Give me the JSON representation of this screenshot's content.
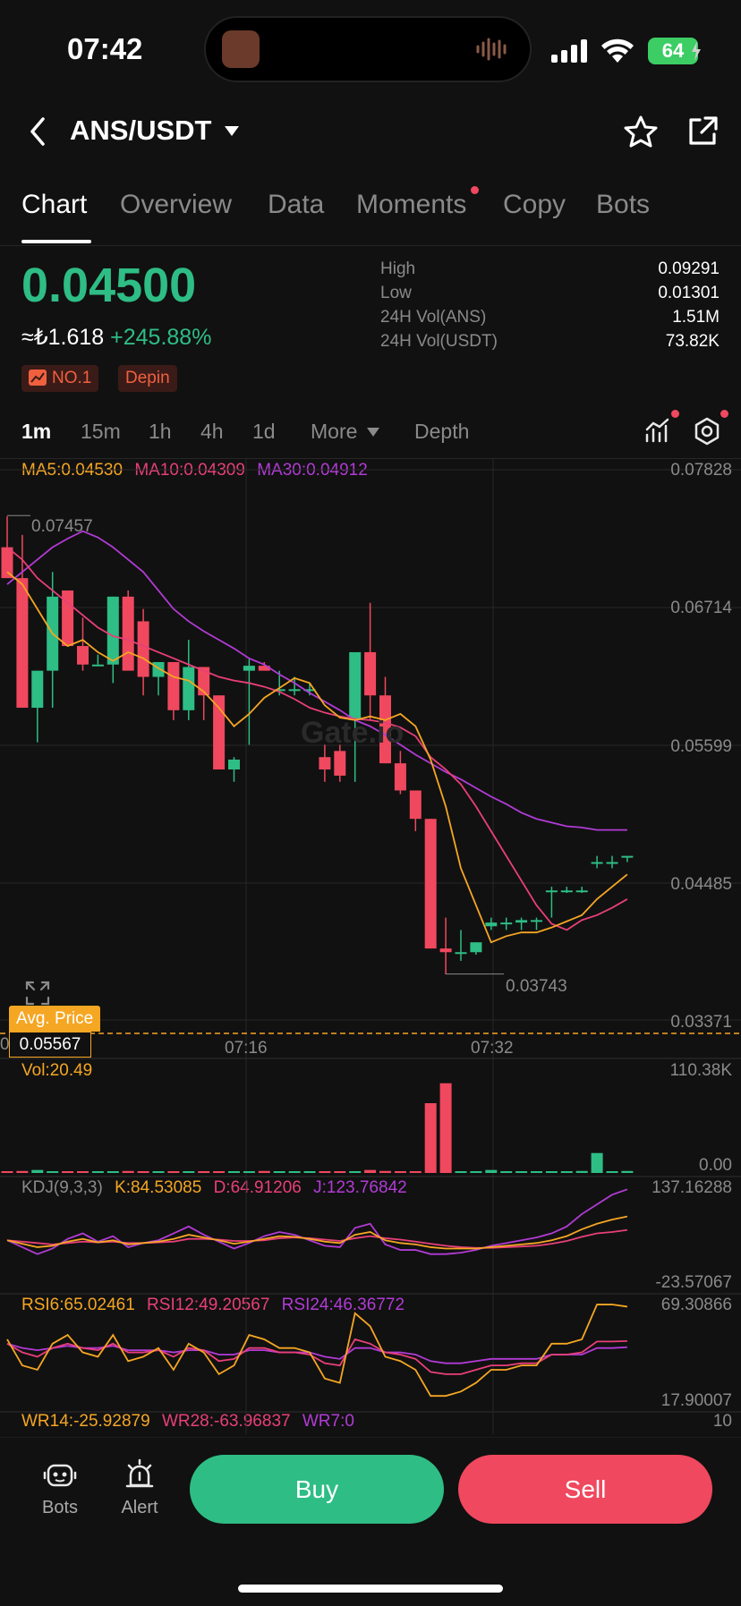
{
  "status_bar": {
    "time": "07:42",
    "battery": "64"
  },
  "header": {
    "pair": "ANS/USDT"
  },
  "tabs": [
    {
      "label": "Chart",
      "active": true
    },
    {
      "label": "Overview"
    },
    {
      "label": "Data"
    },
    {
      "label": "Moments",
      "dot": true
    },
    {
      "label": "Copy"
    },
    {
      "label": "Bots"
    }
  ],
  "ticker": {
    "price": "0.04500",
    "fiat": "≈₺1.618",
    "change": "+245.88%",
    "badges": [
      "NO.1",
      "Depin"
    ],
    "stats": [
      {
        "label": "High",
        "value": "0.09291"
      },
      {
        "label": "Low",
        "value": "0.01301"
      },
      {
        "label": "24H Vol(ANS)",
        "value": "1.51M"
      },
      {
        "label": "24H Vol(USDT)",
        "value": "73.82K"
      }
    ]
  },
  "intervals": {
    "items": [
      "1m",
      "15m",
      "1h",
      "4h",
      "1d",
      "More"
    ],
    "active": "1m",
    "depth_label": "Depth"
  },
  "indicators": {
    "ma": {
      "ma5": "MA5:0.04530",
      "ma10": "MA10:0.04309",
      "ma30": "MA30:0.04912"
    },
    "vol": "Vol:20.49",
    "kdj": {
      "title": "KDJ(9,3,3)",
      "k": "K:84.53085",
      "d": "D:64.91206",
      "j": "J:123.76842"
    },
    "rsi": {
      "r6": "RSI6:65.02461",
      "r12": "RSI12:49.20567",
      "r24": "RSI24:46.36772"
    },
    "wr": {
      "w14": "WR14:-25.92879",
      "w28": "WR28:-63.96837",
      "w7": "WR7:0"
    }
  },
  "axes": {
    "price": [
      "0.07828",
      "0.06714",
      "0.05599",
      "0.04485",
      "0.03371"
    ],
    "volume": [
      "110.38K",
      "0.00"
    ],
    "kdj": [
      "137.16288",
      "-23.57067"
    ],
    "rsi": [
      "69.30866",
      "17.90007"
    ],
    "wr": [
      "10"
    ],
    "time": [
      "07:16",
      "07:32"
    ]
  },
  "chart_labels": {
    "max_marker": "0.07457",
    "min_marker": "0.03743",
    "avg_price_label": "Avg. Price",
    "avg_price_value": "0.05567",
    "avg_price_axis_prefix": "0",
    "watermark": "Gate.io"
  },
  "chart_data": {
    "type": "candlestick",
    "x": [
      "07:01",
      "07:02",
      "07:03",
      "07:04",
      "07:05",
      "07:06",
      "07:07",
      "07:08",
      "07:09",
      "07:10",
      "07:11",
      "07:12",
      "07:13",
      "07:14",
      "07:15",
      "07:16",
      "07:17",
      "07:18",
      "07:19",
      "07:20",
      "07:21",
      "07:22",
      "07:23",
      "07:24",
      "07:25",
      "07:26",
      "07:27",
      "07:28",
      "07:29",
      "07:30",
      "07:31",
      "07:32",
      "07:33",
      "07:34",
      "07:35",
      "07:36",
      "07:37",
      "07:38",
      "07:39",
      "07:40",
      "07:41",
      "07:42"
    ],
    "open": [
      0.072,
      0.0695,
      0.059,
      0.062,
      0.0685,
      0.064,
      0.0625,
      0.0625,
      0.068,
      0.066,
      0.0615,
      0.0627,
      0.0588,
      0.0623,
      0.06,
      0.054,
      0.062,
      0.0624,
      0.0605,
      0.0605,
      0.0605,
      0.055,
      0.0555,
      0.058,
      0.0635,
      0.06,
      0.0545,
      0.0523,
      0.05,
      0.0395,
      0.0392,
      0.0392,
      0.0413,
      0.0416,
      0.0416,
      0.0418,
      0.0442,
      0.0442,
      0.0442,
      0.0465,
      0.0465,
      0.047
    ],
    "high": [
      0.0745,
      0.073,
      0.062,
      0.07,
      0.068,
      0.0663,
      0.0633,
      0.068,
      0.0685,
      0.067,
      0.062,
      0.0627,
      0.0645,
      0.0623,
      0.06,
      0.055,
      0.063,
      0.0627,
      0.062,
      0.0615,
      0.061,
      0.056,
      0.056,
      0.0635,
      0.0675,
      0.0615,
      0.0555,
      0.0523,
      0.05,
      0.042,
      0.041,
      0.04,
      0.042,
      0.042,
      0.042,
      0.042,
      0.0445,
      0.0445,
      0.0445,
      0.047,
      0.047,
      0.047
    ],
    "low": [
      0.07,
      0.059,
      0.0562,
      0.059,
      0.068,
      0.062,
      0.0625,
      0.061,
      0.065,
      0.06,
      0.06,
      0.058,
      0.058,
      0.058,
      0.056,
      0.053,
      0.056,
      0.0622,
      0.06,
      0.06,
      0.06,
      0.053,
      0.053,
      0.053,
      0.058,
      0.0545,
      0.052,
      0.049,
      0.0395,
      0.0374,
      0.0385,
      0.039,
      0.041,
      0.041,
      0.041,
      0.041,
      0.042,
      0.044,
      0.044,
      0.046,
      0.046,
      0.0465
    ],
    "close": [
      0.0695,
      0.059,
      0.062,
      0.068,
      0.064,
      0.0625,
      0.0625,
      0.068,
      0.062,
      0.0615,
      0.0627,
      0.0588,
      0.0623,
      0.06,
      0.054,
      0.0548,
      0.0624,
      0.062,
      0.0605,
      0.0605,
      0.0605,
      0.054,
      0.0535,
      0.0635,
      0.06,
      0.0545,
      0.0523,
      0.05,
      0.0395,
      0.0392,
      0.0392,
      0.04,
      0.0416,
      0.0416,
      0.0418,
      0.0418,
      0.0442,
      0.0442,
      0.0442,
      0.0465,
      0.0465,
      0.047
    ],
    "volume_k": [
      0,
      2,
      3,
      1,
      0,
      1,
      1,
      0,
      2,
      1,
      1,
      0,
      0,
      1,
      1,
      1,
      1,
      2,
      1,
      1,
      1,
      0,
      0,
      0,
      3,
      2,
      0,
      1,
      70,
      90,
      0,
      0,
      3,
      0,
      0,
      0,
      0,
      0,
      2,
      20,
      0,
      2
    ],
    "ma5": [
      0.07,
      0.069,
      0.067,
      0.065,
      0.064,
      0.0645,
      0.0635,
      0.0628,
      0.0635,
      0.063,
      0.0622,
      0.0615,
      0.0612,
      0.0603,
      0.059,
      0.0575,
      0.0585,
      0.0598,
      0.0606,
      0.0614,
      0.061,
      0.0592,
      0.0582,
      0.058,
      0.0583,
      0.058,
      0.0585,
      0.0575,
      0.0548,
      0.051,
      0.046,
      0.043,
      0.04,
      0.0405,
      0.0408,
      0.0408,
      0.0412,
      0.0417,
      0.0422,
      0.0435,
      0.0445,
      0.0455
    ],
    "ma10": [
      0.072,
      0.071,
      0.0695,
      0.0685,
      0.0675,
      0.0665,
      0.0655,
      0.0648,
      0.0645,
      0.064,
      0.0635,
      0.063,
      0.0625,
      0.062,
      0.0615,
      0.0612,
      0.061,
      0.0607,
      0.0603,
      0.0597,
      0.059,
      0.0586,
      0.0583,
      0.0581,
      0.058,
      0.0578,
      0.0574,
      0.0567,
      0.055,
      0.054,
      0.0528,
      0.051,
      0.049,
      0.047,
      0.045,
      0.043,
      0.0415,
      0.041,
      0.0418,
      0.0422,
      0.0428,
      0.0435
    ],
    "ma30": [
      0.069,
      0.07,
      0.071,
      0.072,
      0.0727,
      0.0733,
      0.0728,
      0.072,
      0.071,
      0.07,
      0.0685,
      0.067,
      0.066,
      0.0652,
      0.0645,
      0.0638,
      0.063,
      0.0625,
      0.0617,
      0.061,
      0.0602,
      0.0595,
      0.0588,
      0.058,
      0.0575,
      0.0568,
      0.056,
      0.0552,
      0.0545,
      0.0538,
      0.0532,
      0.0525,
      0.0518,
      0.0512,
      0.0505,
      0.05,
      0.0497,
      0.0494,
      0.0493,
      0.0491,
      0.0491,
      0.0491
    ],
    "ylim": [
      0.03371,
      0.07828
    ],
    "volume_ylim": [
      0,
      110.38
    ],
    "kdj": {
      "ylim": [
        -23.57067,
        137.16288
      ],
      "k": [
        50,
        45,
        40,
        42,
        48,
        52,
        47,
        50,
        44,
        46,
        48,
        52,
        58,
        54,
        50,
        45,
        48,
        52,
        56,
        55,
        52,
        48,
        46,
        58,
        62,
        50,
        46,
        44,
        40,
        38,
        38,
        38,
        40,
        42,
        44,
        46,
        50,
        56,
        66,
        74,
        80,
        84.53
      ],
      "d": [
        50,
        48,
        46,
        44,
        46,
        48,
        47,
        48,
        46,
        46,
        47,
        48,
        52,
        52,
        51,
        49,
        49,
        50,
        53,
        54,
        53,
        51,
        49,
        53,
        56,
        53,
        51,
        48,
        45,
        42,
        40,
        39,
        39,
        40,
        41,
        42,
        45,
        49,
        55,
        60,
        62,
        64.91
      ],
      "j": [
        50,
        40,
        30,
        38,
        52,
        60,
        48,
        56,
        40,
        46,
        50,
        60,
        70,
        58,
        48,
        38,
        46,
        56,
        62,
        58,
        50,
        42,
        40,
        68,
        74,
        44,
        36,
        36,
        30,
        30,
        32,
        36,
        42,
        46,
        50,
        54,
        60,
        70,
        88,
        102,
        116,
        123.77
      ]
    },
    "rsi": {
      "ylim": [
        17.90007,
        69.30866
      ],
      "rsi6": [
        50,
        38,
        36,
        48,
        52,
        44,
        42,
        52,
        40,
        42,
        46,
        36,
        48,
        44,
        34,
        38,
        52,
        50,
        46,
        46,
        44,
        32,
        30,
        62,
        56,
        42,
        40,
        36,
        24,
        24,
        26,
        30,
        36,
        36,
        38,
        38,
        48,
        48,
        50,
        66,
        66,
        65.02
      ],
      "rsi12": [
        48,
        44,
        42,
        46,
        48,
        46,
        45,
        48,
        44,
        44,
        45,
        42,
        46,
        45,
        40,
        41,
        46,
        46,
        44,
        44,
        43,
        39,
        38,
        50,
        48,
        44,
        43,
        41,
        35,
        34,
        34,
        36,
        38,
        38,
        39,
        39,
        43,
        43,
        44,
        49,
        49,
        49.21
      ],
      "rsi24": [
        48,
        46,
        45,
        46,
        47,
        46,
        46,
        47,
        45,
        45,
        45,
        44,
        45,
        45,
        43,
        43,
        45,
        45,
        44,
        44,
        44,
        42,
        41,
        46,
        46,
        44,
        44,
        43,
        40,
        39,
        39,
        40,
        41,
        41,
        41,
        41,
        43,
        43,
        43,
        46,
        46,
        46.37
      ]
    }
  },
  "bottom_bar": {
    "bots_label": "Bots",
    "alert_label": "Alert",
    "buy_label": "Buy",
    "sell_label": "Sell"
  },
  "colors": {
    "up": "#2ebd85",
    "down": "#f0485e",
    "ma5": "#f5a623",
    "ma10": "#e83f79",
    "ma30": "#b23bd6",
    "background": "#111111",
    "avg_line": "#f5a623"
  }
}
